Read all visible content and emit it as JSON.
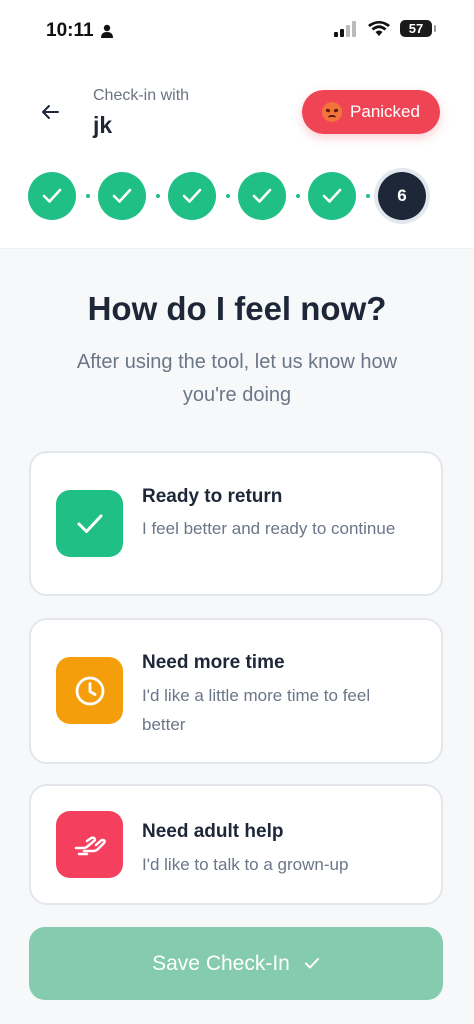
{
  "status_bar": {
    "time": "10:11",
    "battery": "57"
  },
  "header": {
    "checkin_label": "Check-in with",
    "name": "jk",
    "mood_label": "Panicked"
  },
  "progress": {
    "completed_steps": 5,
    "current_step": "6"
  },
  "main": {
    "title": "How do I feel now?",
    "subtitle": "After using the tool, let us know how you're doing"
  },
  "options": [
    {
      "title": "Ready to return",
      "description": "I feel better and ready to continue",
      "icon": "check-icon",
      "color": "#1fbf86"
    },
    {
      "title": "Need more time",
      "description": "I'd like a little more time to feel better",
      "icon": "clock-icon",
      "color": "#f59e0b"
    },
    {
      "title": "Need adult help",
      "description": "I'd like to talk to a grown-up",
      "icon": "helping-hand-icon",
      "color": "#f43f5e"
    }
  ],
  "save_button": {
    "label": "Save Check-In"
  },
  "colors": {
    "accent_green": "#1fbf86",
    "panic_red": "#ef4453",
    "dark": "#1e2738"
  }
}
